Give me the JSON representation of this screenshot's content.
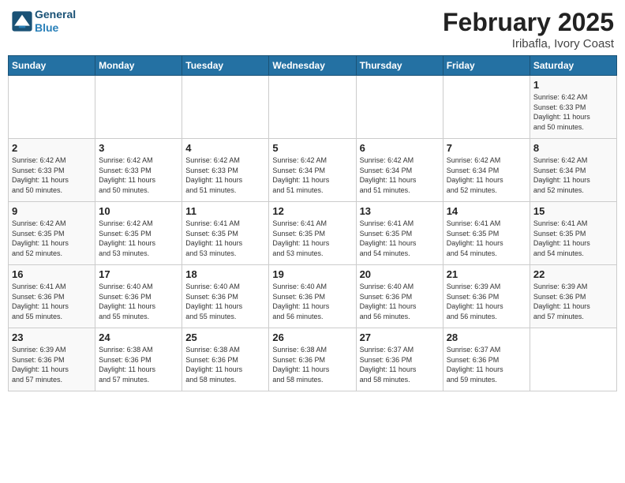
{
  "header": {
    "logo_line1": "General",
    "logo_line2": "Blue",
    "main_title": "February 2025",
    "subtitle": "Iribafla, Ivory Coast"
  },
  "days_of_week": [
    "Sunday",
    "Monday",
    "Tuesday",
    "Wednesday",
    "Thursday",
    "Friday",
    "Saturday"
  ],
  "weeks": [
    [
      {
        "day": "",
        "info": ""
      },
      {
        "day": "",
        "info": ""
      },
      {
        "day": "",
        "info": ""
      },
      {
        "day": "",
        "info": ""
      },
      {
        "day": "",
        "info": ""
      },
      {
        "day": "",
        "info": ""
      },
      {
        "day": "1",
        "info": "Sunrise: 6:42 AM\nSunset: 6:33 PM\nDaylight: 11 hours\nand 50 minutes."
      }
    ],
    [
      {
        "day": "2",
        "info": "Sunrise: 6:42 AM\nSunset: 6:33 PM\nDaylight: 11 hours\nand 50 minutes."
      },
      {
        "day": "3",
        "info": "Sunrise: 6:42 AM\nSunset: 6:33 PM\nDaylight: 11 hours\nand 50 minutes."
      },
      {
        "day": "4",
        "info": "Sunrise: 6:42 AM\nSunset: 6:33 PM\nDaylight: 11 hours\nand 51 minutes."
      },
      {
        "day": "5",
        "info": "Sunrise: 6:42 AM\nSunset: 6:34 PM\nDaylight: 11 hours\nand 51 minutes."
      },
      {
        "day": "6",
        "info": "Sunrise: 6:42 AM\nSunset: 6:34 PM\nDaylight: 11 hours\nand 51 minutes."
      },
      {
        "day": "7",
        "info": "Sunrise: 6:42 AM\nSunset: 6:34 PM\nDaylight: 11 hours\nand 52 minutes."
      },
      {
        "day": "8",
        "info": "Sunrise: 6:42 AM\nSunset: 6:34 PM\nDaylight: 11 hours\nand 52 minutes."
      }
    ],
    [
      {
        "day": "9",
        "info": "Sunrise: 6:42 AM\nSunset: 6:35 PM\nDaylight: 11 hours\nand 52 minutes."
      },
      {
        "day": "10",
        "info": "Sunrise: 6:42 AM\nSunset: 6:35 PM\nDaylight: 11 hours\nand 53 minutes."
      },
      {
        "day": "11",
        "info": "Sunrise: 6:41 AM\nSunset: 6:35 PM\nDaylight: 11 hours\nand 53 minutes."
      },
      {
        "day": "12",
        "info": "Sunrise: 6:41 AM\nSunset: 6:35 PM\nDaylight: 11 hours\nand 53 minutes."
      },
      {
        "day": "13",
        "info": "Sunrise: 6:41 AM\nSunset: 6:35 PM\nDaylight: 11 hours\nand 54 minutes."
      },
      {
        "day": "14",
        "info": "Sunrise: 6:41 AM\nSunset: 6:35 PM\nDaylight: 11 hours\nand 54 minutes."
      },
      {
        "day": "15",
        "info": "Sunrise: 6:41 AM\nSunset: 6:35 PM\nDaylight: 11 hours\nand 54 minutes."
      }
    ],
    [
      {
        "day": "16",
        "info": "Sunrise: 6:41 AM\nSunset: 6:36 PM\nDaylight: 11 hours\nand 55 minutes."
      },
      {
        "day": "17",
        "info": "Sunrise: 6:40 AM\nSunset: 6:36 PM\nDaylight: 11 hours\nand 55 minutes."
      },
      {
        "day": "18",
        "info": "Sunrise: 6:40 AM\nSunset: 6:36 PM\nDaylight: 11 hours\nand 55 minutes."
      },
      {
        "day": "19",
        "info": "Sunrise: 6:40 AM\nSunset: 6:36 PM\nDaylight: 11 hours\nand 56 minutes."
      },
      {
        "day": "20",
        "info": "Sunrise: 6:40 AM\nSunset: 6:36 PM\nDaylight: 11 hours\nand 56 minutes."
      },
      {
        "day": "21",
        "info": "Sunrise: 6:39 AM\nSunset: 6:36 PM\nDaylight: 11 hours\nand 56 minutes."
      },
      {
        "day": "22",
        "info": "Sunrise: 6:39 AM\nSunset: 6:36 PM\nDaylight: 11 hours\nand 57 minutes."
      }
    ],
    [
      {
        "day": "23",
        "info": "Sunrise: 6:39 AM\nSunset: 6:36 PM\nDaylight: 11 hours\nand 57 minutes."
      },
      {
        "day": "24",
        "info": "Sunrise: 6:38 AM\nSunset: 6:36 PM\nDaylight: 11 hours\nand 57 minutes."
      },
      {
        "day": "25",
        "info": "Sunrise: 6:38 AM\nSunset: 6:36 PM\nDaylight: 11 hours\nand 58 minutes."
      },
      {
        "day": "26",
        "info": "Sunrise: 6:38 AM\nSunset: 6:36 PM\nDaylight: 11 hours\nand 58 minutes."
      },
      {
        "day": "27",
        "info": "Sunrise: 6:37 AM\nSunset: 6:36 PM\nDaylight: 11 hours\nand 58 minutes."
      },
      {
        "day": "28",
        "info": "Sunrise: 6:37 AM\nSunset: 6:36 PM\nDaylight: 11 hours\nand 59 minutes."
      },
      {
        "day": "",
        "info": ""
      }
    ]
  ]
}
